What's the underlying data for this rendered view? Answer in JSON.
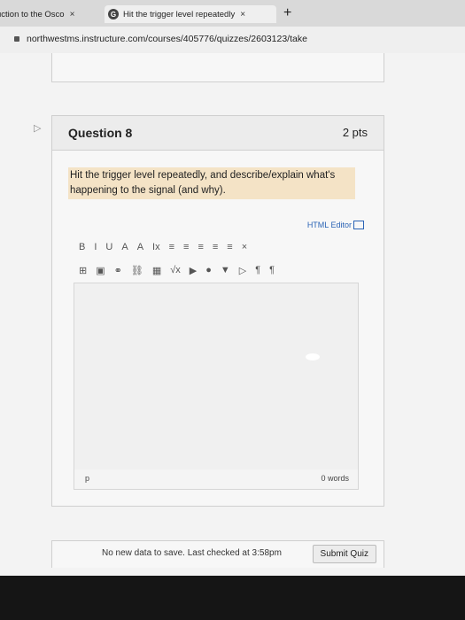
{
  "tabs": [
    {
      "label": "uction to the Osco",
      "close": "×"
    },
    {
      "label": "Hit the trigger level repeatedly",
      "close": "×"
    }
  ],
  "new_tab": "+",
  "url": "northwestms.instructure.com/courses/405776/quizzes/2603123/take",
  "question": {
    "title": "Question 8",
    "points": "2 pts",
    "prompt": "Hit the trigger level repeatedly, and describe/explain what's happening to the signal (and why)."
  },
  "editor": {
    "html_editor_link": "HTML Editor",
    "path": "p",
    "word_count": "0 words",
    "toolbar_row1": [
      "B",
      "I",
      "U",
      "A",
      "A",
      "Ix",
      "≡",
      "≡",
      "≡",
      "≡",
      "≡",
      "×"
    ],
    "toolbar_row2": [
      "⊞",
      "▣",
      "⚭",
      "⛓",
      "▦",
      "√x",
      "▶",
      "●",
      "▼",
      "▷",
      "¶",
      "¶"
    ]
  },
  "footer": {
    "status": "No new data to save. Last checked at 3:58pm",
    "submit_label": "Submit Quiz"
  }
}
